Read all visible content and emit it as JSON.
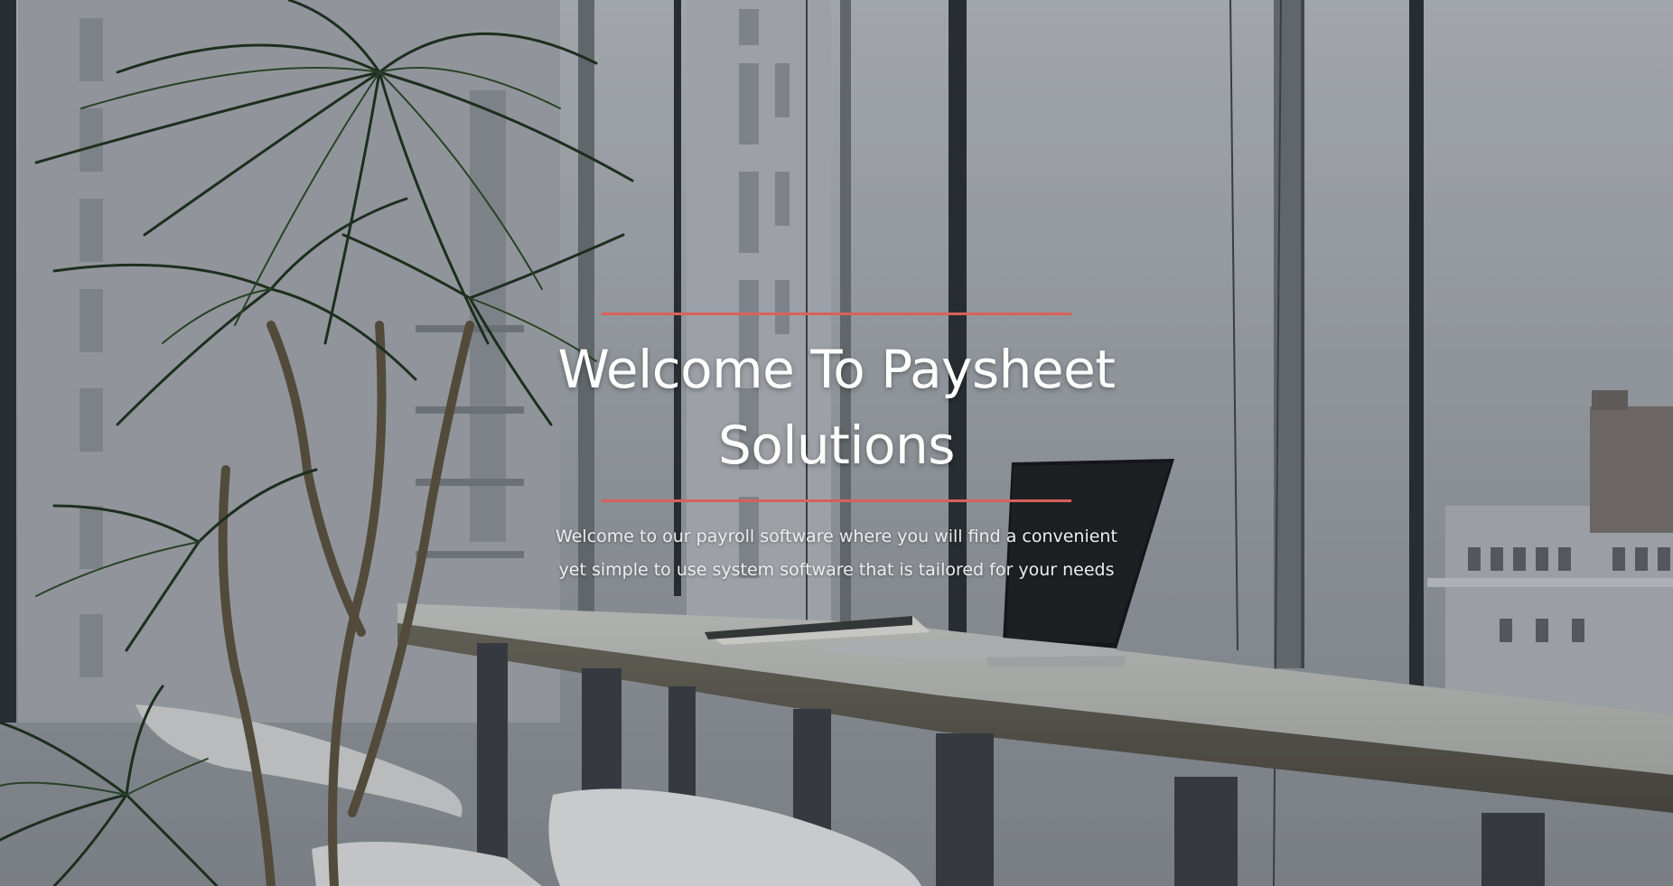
{
  "hero": {
    "title_line1": "Welcome To Paysheet",
    "title_line2": "Solutions",
    "subtitle_line1": "Welcome to our payroll software where you will find a convenient",
    "subtitle_line2": "yet simple to use system software that is tailored for your needs",
    "accent_color": "#d9605c"
  }
}
